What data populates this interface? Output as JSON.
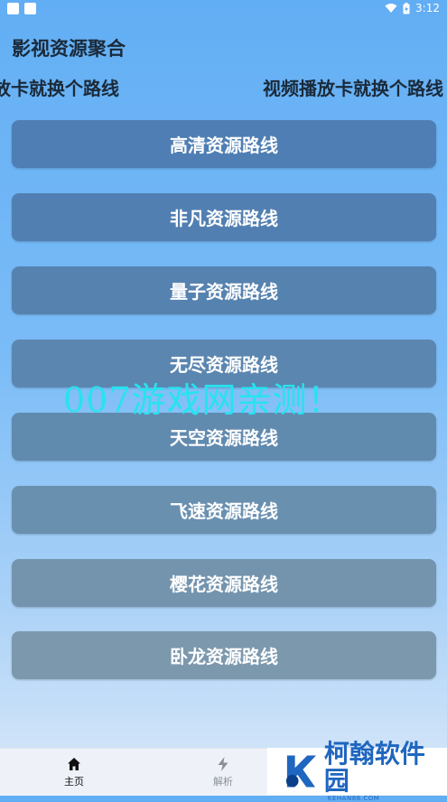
{
  "status_bar": {
    "time": "3:12",
    "battery_icon": "battery-charging-icon",
    "wifi_icon": "wifi-icon"
  },
  "header": {
    "title": "影视资源聚合"
  },
  "marquee": {
    "text_left": "播放卡就换个路线",
    "text_right": "视频播放卡就换个路线"
  },
  "routes": [
    {
      "label": "高清资源路线",
      "color": "#4e7eb3"
    },
    {
      "label": "非凡资源路线",
      "color": "#517fb1"
    },
    {
      "label": "量子资源路线",
      "color": "#5682b0"
    },
    {
      "label": "无尽资源路线",
      "color": "#5b86b0"
    },
    {
      "label": "天空资源路线",
      "color": "#618aaf"
    },
    {
      "label": "飞速资源路线",
      "color": "#6a90b0"
    },
    {
      "label": "樱花资源路线",
      "color": "#7494ae"
    },
    {
      "label": "卧龙资源路线",
      "color": "#7c98ad"
    }
  ],
  "watermark": {
    "text": "007游戏网亲测！"
  },
  "tabbar": {
    "tabs": [
      {
        "label": "主页",
        "icon": "home-icon",
        "active": true
      },
      {
        "label": "解析",
        "icon": "lightning-icon",
        "active": false
      }
    ]
  },
  "logo": {
    "name": "柯翰软件园",
    "domain": "KEHAN88.COM"
  }
}
